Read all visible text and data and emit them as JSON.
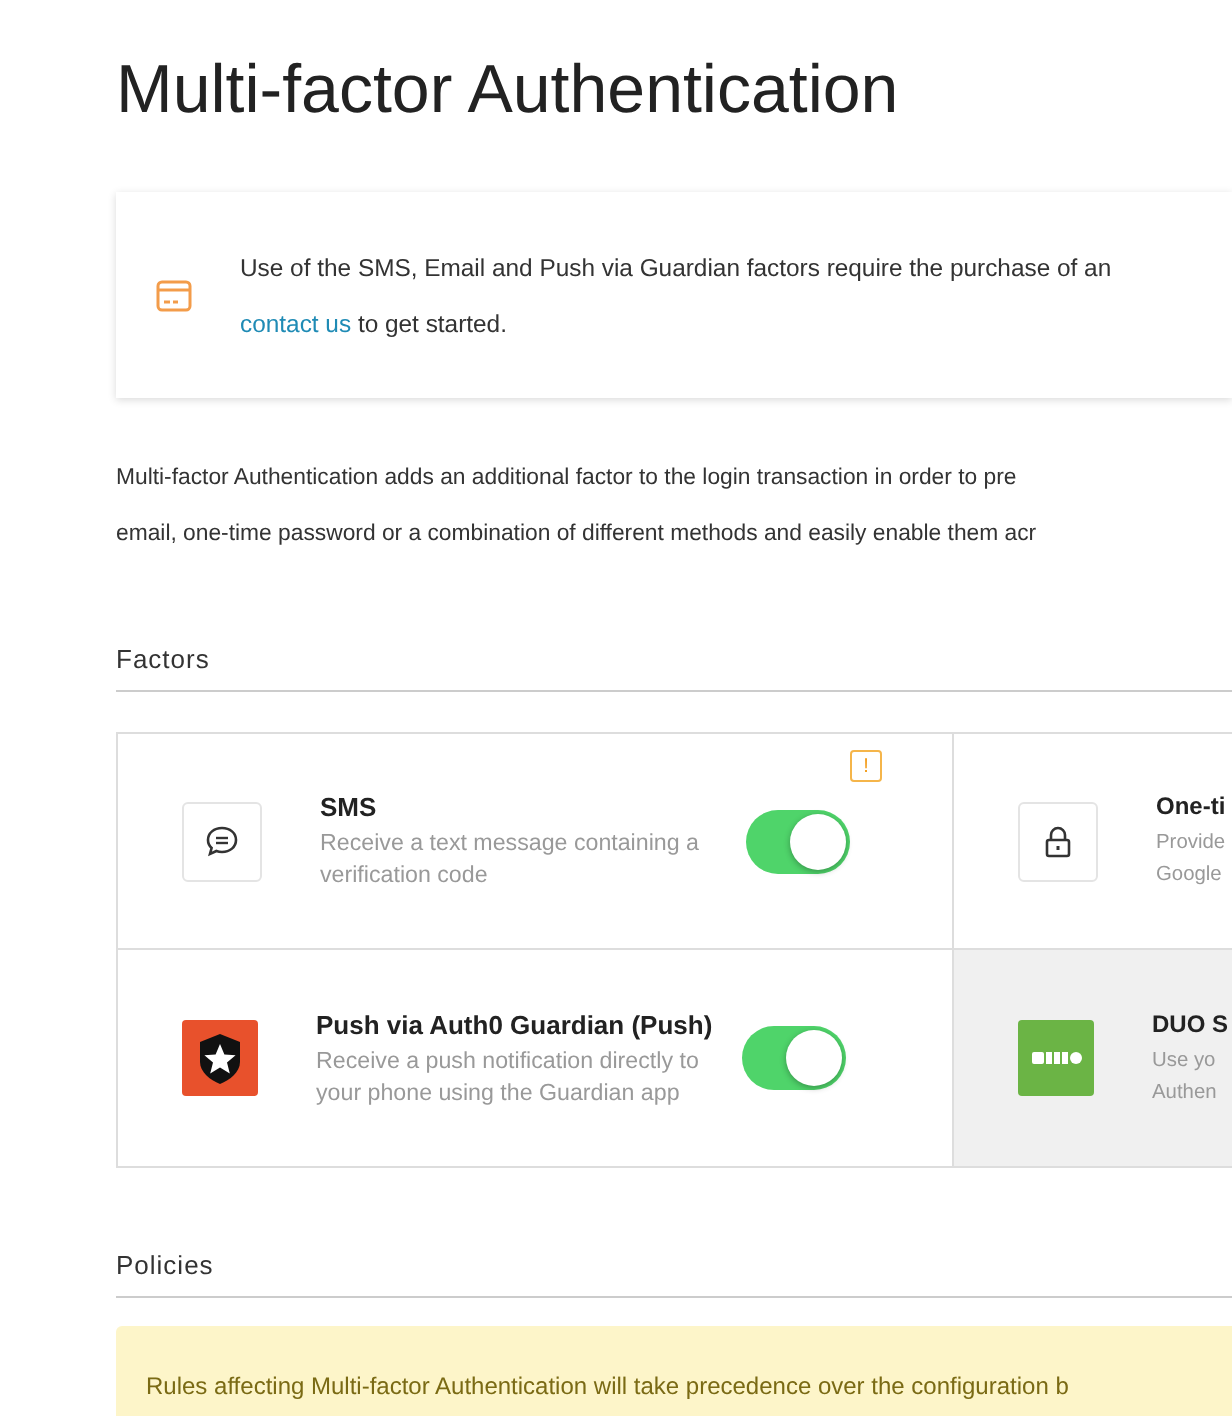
{
  "title": "Multi-factor Authentication",
  "notice": {
    "text": "Use of the SMS, Email and Push via Guardian factors require the purchase of an",
    "link": "contact us",
    "after_link": "to get started."
  },
  "intro": [
    "Multi-factor Authentication adds an additional factor to the login transaction in order to pre",
    "email, one-time password or a combination of different methods and easily enable them acr"
  ],
  "factors_heading": "Factors",
  "factors": [
    {
      "kind": "chat",
      "title": "SMS",
      "description": "Receive a text message containing a verification code",
      "on": true,
      "warning": "!",
      "selected": false
    },
    {
      "kind": "lock",
      "title": "One-ti",
      "description_lines": [
        "Provide",
        "Google"
      ],
      "selected": false
    },
    {
      "kind": "guardian",
      "title": "Push via Auth0 Guardian (Push)",
      "description": "Receive a push notification directly to your phone using the Guardian app",
      "on": true,
      "selected": false
    },
    {
      "kind": "duo",
      "title": "DUO S",
      "description_lines": [
        "Use yo",
        "Authen"
      ],
      "selected": true
    }
  ],
  "policies_heading": "Policies",
  "policy_notice": "Rules affecting Multi-factor Authentication will take precedence over the configuration b"
}
